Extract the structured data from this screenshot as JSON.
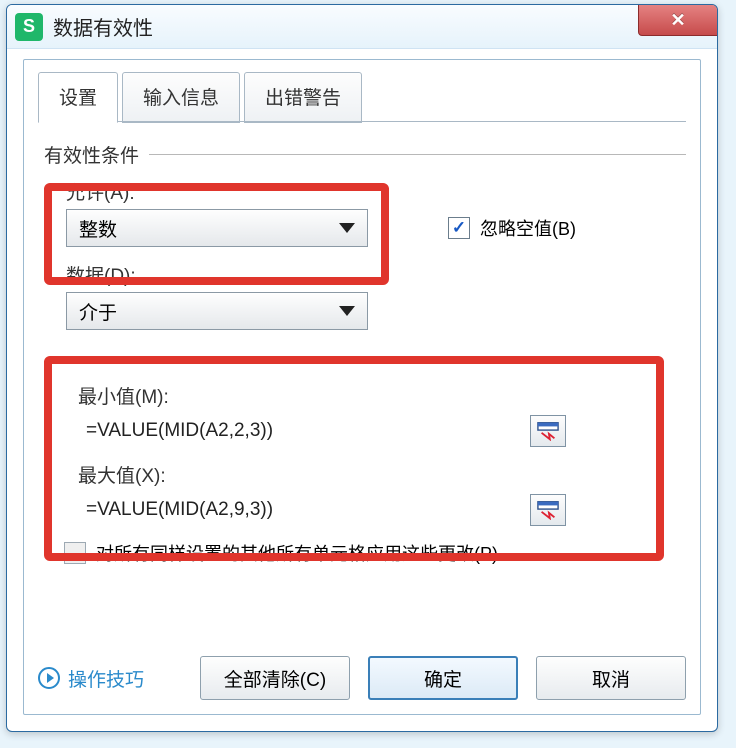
{
  "window": {
    "title": "数据有效性",
    "app_icon_letter": "S",
    "close_label": "✕"
  },
  "tabs": {
    "settings": "设置",
    "input_msg": "输入信息",
    "error_alert": "出错警告"
  },
  "group": {
    "criteria": "有效性条件"
  },
  "allow": {
    "label": "允许(A):",
    "value": "整数"
  },
  "ignore_blank": {
    "label": "忽略空值(B)",
    "checked": true
  },
  "data": {
    "label": "数据(D):",
    "value": "介于"
  },
  "min": {
    "label": "最小值(M):",
    "value": "=VALUE(MID(A2,2,3))"
  },
  "max": {
    "label": "最大值(X):",
    "value": "=VALUE(MID(A2,9,3))"
  },
  "apply_all": {
    "label": "对所有同样设置的其他所有单元格应用这些更改(P)"
  },
  "footer": {
    "tips": "操作技巧",
    "clear_all": "全部清除(C)",
    "ok": "确定",
    "cancel": "取消"
  }
}
